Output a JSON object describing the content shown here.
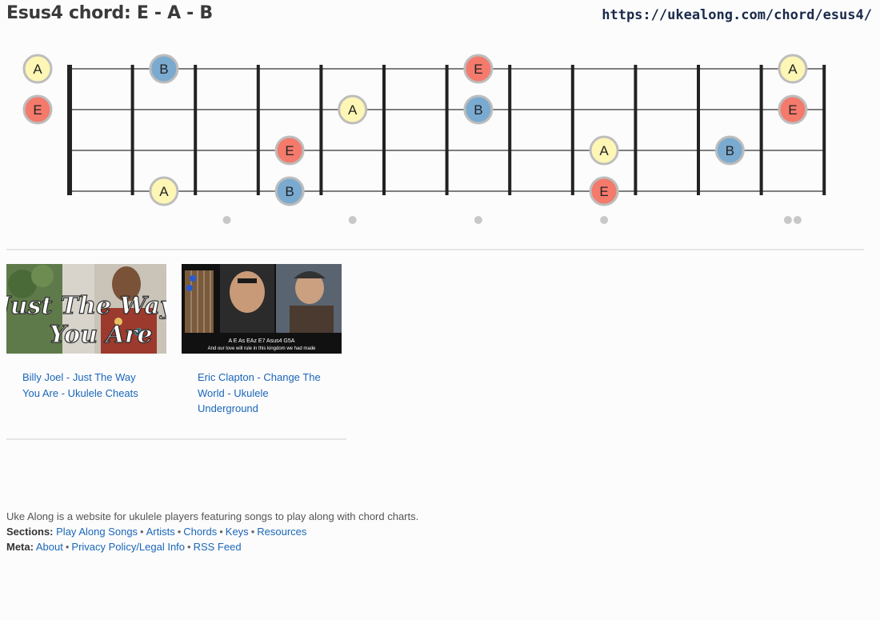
{
  "page_title": "Esus4 chord: E - A - B",
  "url": "https://ukealong.com/chord/esus4/",
  "fretboard": {
    "frets": 12,
    "strings": 4,
    "fret_markers": [
      3,
      5,
      7,
      9
    ],
    "double_marker": 12,
    "note_colors": {
      "A": "#fdf6b4",
      "E": "#f47a6c",
      "B": "#7aaad0"
    },
    "notes": [
      {
        "string": 1,
        "fret": 0,
        "note": "A"
      },
      {
        "string": 1,
        "fret": 2,
        "note": "B"
      },
      {
        "string": 1,
        "fret": 7,
        "note": "E"
      },
      {
        "string": 1,
        "fret": 12,
        "note": "A"
      },
      {
        "string": 2,
        "fret": 0,
        "note": "E"
      },
      {
        "string": 2,
        "fret": 5,
        "note": "A"
      },
      {
        "string": 2,
        "fret": 7,
        "note": "B"
      },
      {
        "string": 2,
        "fret": 12,
        "note": "E"
      },
      {
        "string": 3,
        "fret": 4,
        "note": "E"
      },
      {
        "string": 3,
        "fret": 9,
        "note": "A"
      },
      {
        "string": 3,
        "fret": 11,
        "note": "B"
      },
      {
        "string": 4,
        "fret": 2,
        "note": "A"
      },
      {
        "string": 4,
        "fret": 4,
        "note": "B"
      },
      {
        "string": 4,
        "fret": 9,
        "note": "E"
      }
    ]
  },
  "videos": [
    {
      "link": "Billy Joel - Just The Way You Are - Ukulele Cheats",
      "thumb_text_1": "Just The Way",
      "thumb_text_2": "You Are"
    },
    {
      "link": "Eric Clapton - Change The World - Ukulele Underground",
      "thumb_chords": "A  E  As  EAz E7 Asus4 G5A",
      "thumb_lyric": "And our love will rule in this kingdom we had made"
    }
  ],
  "footer": {
    "about_text": "Uke Along is a website for ukulele players featuring songs to play along with chord charts.",
    "sections_label": "Sections:",
    "sections": [
      "Play Along Songs",
      "Artists",
      "Chords",
      "Keys",
      "Resources"
    ],
    "meta_label": "Meta:",
    "meta": [
      "About",
      "Privacy Policy/Legal Info",
      "RSS Feed"
    ]
  }
}
